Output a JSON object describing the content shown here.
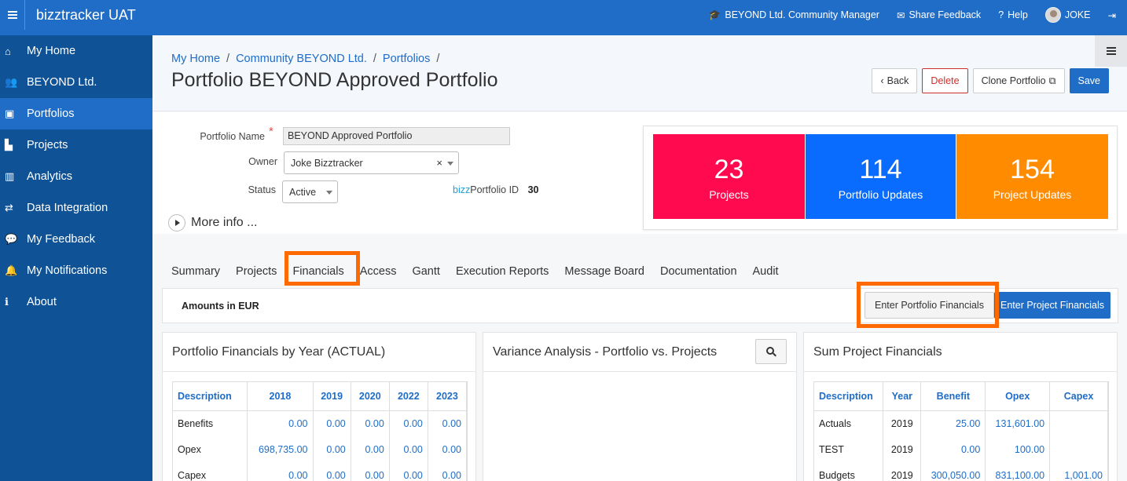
{
  "topbar": {
    "app_title": "bizztracker UAT",
    "community_manager": "BEYOND Ltd. Community Manager",
    "share_feedback": "Share Feedback",
    "help": "Help",
    "user": "JOKE"
  },
  "sidebar": {
    "items": [
      {
        "label": "My Home",
        "icon": "home-icon"
      },
      {
        "label": "BEYOND Ltd.",
        "icon": "users-icon"
      },
      {
        "label": "Portfolios",
        "icon": "briefcase-icon",
        "active": true
      },
      {
        "label": "Projects",
        "icon": "area-chart-icon"
      },
      {
        "label": "Analytics",
        "icon": "bar-chart-icon"
      },
      {
        "label": "Data Integration",
        "icon": "exchange-icon"
      },
      {
        "label": "My Feedback",
        "icon": "comments-icon"
      },
      {
        "label": "My Notifications",
        "icon": "bell-icon"
      },
      {
        "label": "About",
        "icon": "info-icon"
      }
    ]
  },
  "breadcrumb": {
    "items": [
      "My Home",
      "Community BEYOND Ltd.",
      "Portfolios"
    ],
    "sep": "/"
  },
  "page": {
    "title": "Portfolio BEYOND Approved Portfolio"
  },
  "actions": {
    "back": "Back",
    "delete": "Delete",
    "clone": "Clone Portfolio",
    "save": "Save"
  },
  "form": {
    "name_label": "Portfolio Name",
    "name_value": "BEYOND Approved Portfolio",
    "owner_label": "Owner",
    "owner_value": "Joke Bizztracker",
    "status_label": "Status",
    "status_value": "Active",
    "id_prefix": "bizz",
    "id_label": "Portfolio ID",
    "id_value": "30",
    "more_info": "More info ..."
  },
  "stats": [
    {
      "value": "23",
      "label": "Projects",
      "color": "#ff0a4e"
    },
    {
      "value": "114",
      "label": "Portfolio Updates",
      "color": "#0a6cff"
    },
    {
      "value": "154",
      "label": "Project Updates",
      "color": "#ff8c00"
    }
  ],
  "tabs": [
    "Summary",
    "Projects",
    "Financials",
    "Access",
    "Gantt",
    "Execution Reports",
    "Message Board",
    "Documentation",
    "Audit"
  ],
  "active_tab": "Financials",
  "highlight_color": "#ff6a00",
  "amounts": {
    "label": "Amounts in EUR",
    "enter_portfolio": "Enter Portfolio Financials",
    "enter_project": "Enter Project Financials"
  },
  "panels": {
    "portfolio_financials": {
      "title": "Portfolio Financials by Year (ACTUAL)",
      "headers": [
        "Description",
        "2018",
        "2019",
        "2020",
        "2022",
        "2023"
      ],
      "rows": [
        [
          "Benefits",
          "0.00",
          "0.00",
          "0.00",
          "0.00",
          "0.00"
        ],
        [
          "Opex",
          "698,735.00",
          "0.00",
          "0.00",
          "0.00",
          "0.00"
        ],
        [
          "Capex",
          "0.00",
          "0.00",
          "0.00",
          "0.00",
          "0.00"
        ]
      ]
    },
    "variance": {
      "title": "Variance Analysis - Portfolio vs. Projects"
    },
    "sum_project": {
      "title": "Sum Project Financials",
      "headers": [
        "Description",
        "Year",
        "Benefit",
        "Opex",
        "Capex"
      ],
      "rows": [
        [
          "Actuals",
          "2019",
          "25.00",
          "131,601.00",
          ""
        ],
        [
          "TEST",
          "2019",
          "0.00",
          "100.00",
          ""
        ],
        [
          "Budgets",
          "2019",
          "300,050.00",
          "831,100.00",
          "1,001.00"
        ]
      ]
    }
  }
}
